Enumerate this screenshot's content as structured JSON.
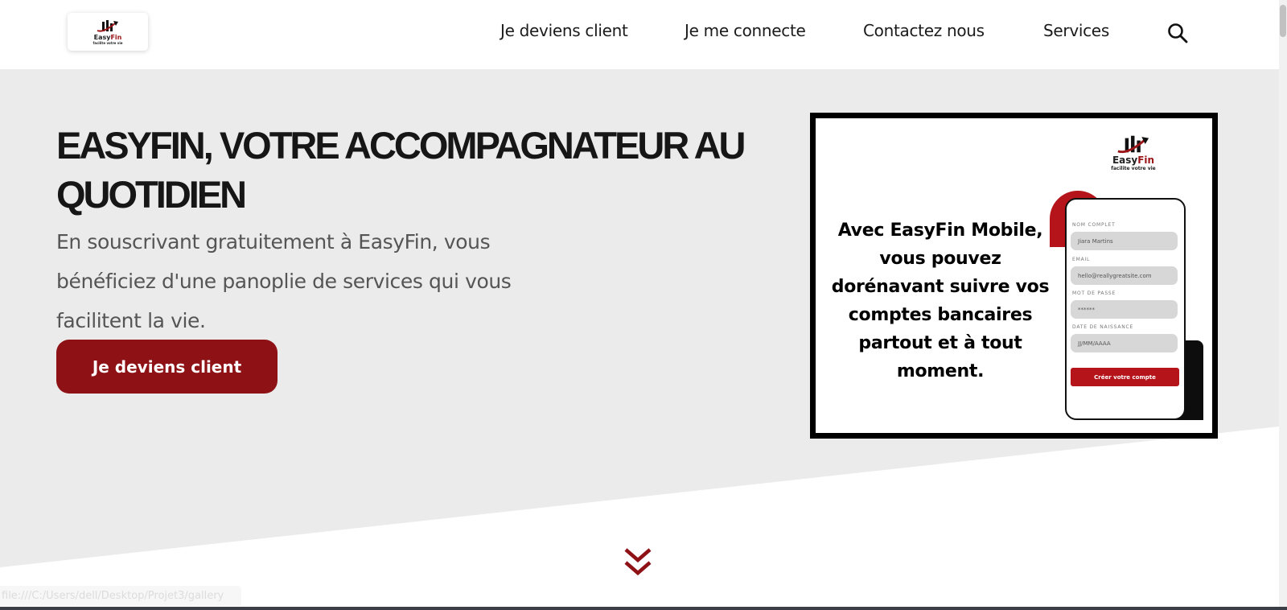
{
  "header": {
    "logo": {
      "name_part1": "Easy",
      "name_part2": "Fin",
      "tagline": "facilite votre vie"
    },
    "nav": [
      {
        "label": "Je deviens client"
      },
      {
        "label": "Je me connecte"
      },
      {
        "label": "Contactez nous"
      },
      {
        "label": "Services"
      }
    ],
    "search_icon": "search-icon"
  },
  "hero": {
    "title": "EASYFIN, VOTRE ACCOMPAGNATEUR AU QUOTIDIEN",
    "text": "En souscrivant gratuitement à EasyFin, vous bénéficiez d'une panoplie de services qui vous facilitent la vie.",
    "cta_label": "Je deviens client"
  },
  "promo": {
    "logo": {
      "name_part1": "Easy",
      "name_part2": "Fin",
      "tagline": "facilite votre vie"
    },
    "text": "Avec EasyFin Mobile, vous pouvez dorénavant suivre vos comptes bancaires partout et à tout moment.",
    "phone_form": {
      "fields": [
        {
          "label": "NOM COMPLET",
          "value": "Jiara Martins"
        },
        {
          "label": "EMAIL",
          "value": "hello@reallygreatsite.com"
        },
        {
          "label": "MOT DE PASSE",
          "value": "******"
        },
        {
          "label": "DATE DE NAISSANCE",
          "value": "JJ/MM/AAAA"
        }
      ],
      "button_label": "Créer votre compte"
    }
  },
  "scroll_down_icon": "double-chevron-down-icon",
  "status_bar": {
    "url": "file:///C:/Users/dell/Desktop/Projet3/gallery"
  },
  "colors": {
    "brand_red": "#8e1215",
    "accent_red": "#b5141a",
    "hero_bg": "#ebebeb"
  }
}
